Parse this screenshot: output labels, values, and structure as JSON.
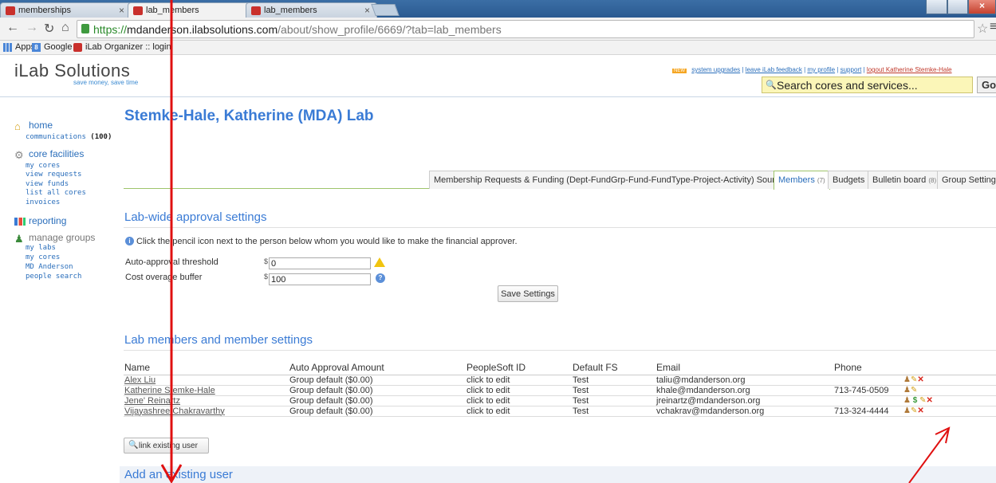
{
  "browser": {
    "tabs": [
      {
        "label": "memberships",
        "favicon": "ilab-icon"
      },
      {
        "label": "lab_members",
        "favicon": "ilab-icon"
      },
      {
        "label": "lab_members",
        "favicon": "ilab-icon"
      }
    ],
    "url": {
      "scheme": "https://",
      "host": "mdanderson.ilabsolutions.com",
      "path": "/about/show_profile/6669/?tab=lab_members"
    },
    "bookmarks": [
      "Apps",
      "Google",
      "iLab Organizer :: login"
    ]
  },
  "site": {
    "logo": "iLab Solutions",
    "tagline": "save money, save time",
    "new_badge": "NEW",
    "top_links": [
      "system upgrades",
      "leave iLab feedback",
      "my profile",
      "support",
      "logout Katherine Stemke-Hale"
    ],
    "search_placeholder": "Search cores and services...",
    "go_label": "Go!"
  },
  "sidebar": {
    "home": {
      "label": "home",
      "icon": "home-icon",
      "items": [
        {
          "label": "communications",
          "count": "(100)"
        }
      ]
    },
    "core": {
      "label": "core facilities",
      "icon": "gear-icon",
      "items": [
        "my cores",
        "view requests",
        "view funds",
        "list all cores",
        "invoices"
      ]
    },
    "reporting": {
      "label": "reporting",
      "icon": "bar-chart-icon"
    },
    "manage": {
      "label": "manage groups",
      "icon": "people-icon",
      "items": [
        "my labs",
        "my cores",
        "MD Anderson",
        "people search"
      ]
    }
  },
  "main": {
    "title": "Stemke-Hale, Katherine (MDA) Lab",
    "tabs": [
      {
        "label": "Membership Requests & Funding (Dept-FundGrp-Fund-FundType-Project-Activity) Sources",
        "count": ""
      },
      {
        "label": "Members",
        "count": "(7)"
      },
      {
        "label": "Budgets",
        "count": ""
      },
      {
        "label": "Bulletin board",
        "count": "(8)"
      },
      {
        "label": "Group Settings",
        "count": ""
      }
    ],
    "approval": {
      "title": "Lab-wide approval settings",
      "hint": "Click the pencil icon next to the person below whom you would like to make the financial approver.",
      "threshold_label": "Auto-approval threshold",
      "threshold_value": "0",
      "buffer_label": "Cost overage buffer",
      "buffer_value": "100",
      "currency": "$",
      "save_label": "Save Settings"
    },
    "members": {
      "title": "Lab members and member settings",
      "columns": [
        "Name",
        "Auto Approval Amount",
        "PeopleSoft ID",
        "Default FS",
        "Email",
        "Phone"
      ],
      "rows": [
        {
          "name": "Alex Liu",
          "auto": "Group default ($0.00)",
          "psid": "click to edit",
          "fs": "Test",
          "email": "taliu@mdanderson.org",
          "phone": ""
        },
        {
          "name": "Katherine Stemke-Hale",
          "auto": "Group default ($0.00)",
          "psid": "click to edit",
          "fs": "Test",
          "email": "khale@mdanderson.org",
          "phone": "713-745-0509"
        },
        {
          "name": "Jene' Reinartz",
          "auto": "Group default ($0.00)",
          "psid": "click to edit",
          "fs": "Test",
          "email": "jreinartz@mdanderson.org",
          "phone": ""
        },
        {
          "name": "Vijayashree Chakravarthy",
          "auto": "Group default ($0.00)",
          "psid": "click to edit",
          "fs": "Test",
          "email": "vchakrav@mdanderson.org",
          "phone": "713-324-4444"
        }
      ],
      "link_user_label": "link existing user"
    },
    "add_title": "Add an existing user"
  },
  "colors": {
    "accent": "#3a7bd5",
    "annotation": "#e01010",
    "tab_border": "#9ec46b"
  }
}
